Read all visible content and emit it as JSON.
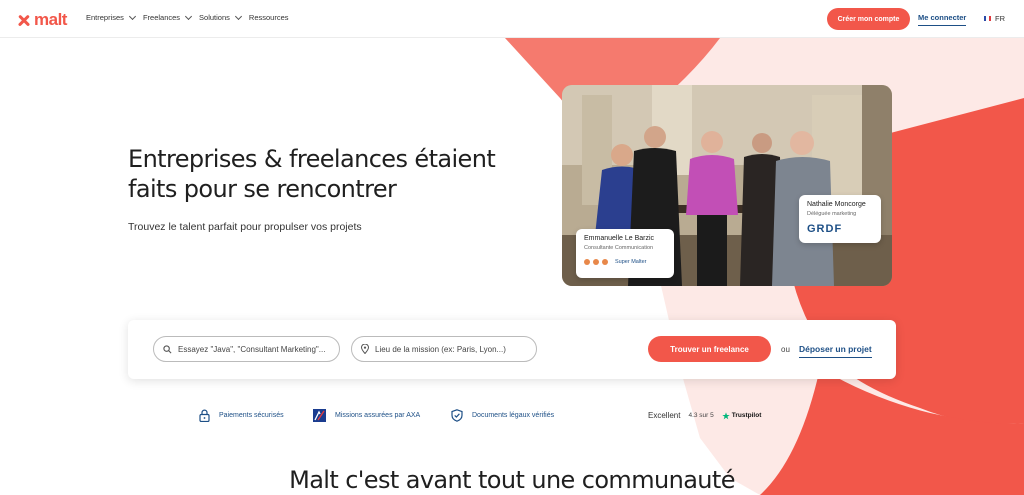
{
  "header": {
    "logo_text": "malt",
    "nav": [
      {
        "label": "Entreprises",
        "has_dropdown": true
      },
      {
        "label": "Freelances",
        "has_dropdown": true
      },
      {
        "label": "Solutions",
        "has_dropdown": true
      },
      {
        "label": "Ressources",
        "has_dropdown": false
      }
    ],
    "create_account": "Créer mon compte",
    "login": "Me connecter",
    "language": "FR"
  },
  "hero": {
    "title_line1": "Entreprises & freelances étaient",
    "title_line2": "faits pour se rencontrer",
    "subtitle": "Trouvez le talent parfait pour propulser vos projets",
    "card_left": {
      "name": "Emmanuelle Le Barzic",
      "role": "Consultante Communication",
      "badge": "Super Malter"
    },
    "card_right": {
      "name": "Nathalie Moncorge",
      "role": "Déléguée marketing",
      "company_logo": "GRDF"
    }
  },
  "search": {
    "query_placeholder": "Essayez \"Java\", \"Consultant Marketing\"...",
    "location_placeholder": "Lieu de la mission (ex: Paris, Lyon...)",
    "find_button": "Trouver un freelance",
    "or": "ou",
    "post_project": "Déposer un projet"
  },
  "trust": {
    "items": [
      {
        "label": "Paiements sécurisés",
        "icon": "lock-icon"
      },
      {
        "label": "Missions assurées par AXA",
        "icon": "axa-logo"
      },
      {
        "label": "Documents légaux vérifiés",
        "icon": "shield-check-icon"
      }
    ],
    "trustpilot": {
      "label": "Excellent",
      "score": "4.3 sur 5",
      "brand": "Trustpilot"
    }
  },
  "section_title": "Malt c'est avant tout une communauté",
  "colors": {
    "brand": "#f2574a",
    "link": "#1d4f86"
  }
}
